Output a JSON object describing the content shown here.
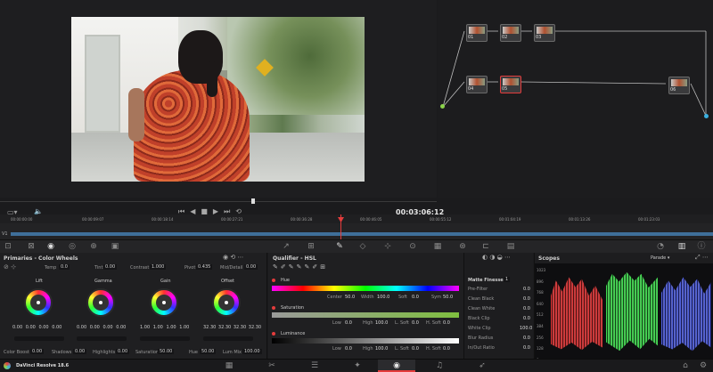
{
  "viewer": {
    "timecode": "00:03:06:12"
  },
  "timeline": {
    "track": "V1",
    "ruler": [
      "00:00:00:00",
      "00:00:09:07",
      "00:00:18:14",
      "00:00:27:21",
      "00:00:36:28",
      "00:00:46:05",
      "00:00:55:12",
      "00:01:04:19",
      "00:01:13:26",
      "00:01:23:03"
    ]
  },
  "nodes": [
    {
      "id": "01"
    },
    {
      "id": "02"
    },
    {
      "id": "03"
    },
    {
      "id": "04"
    },
    {
      "id": "05"
    },
    {
      "id": "06"
    }
  ],
  "primaries": {
    "title": "Primaries - Color Wheels",
    "top_params": [
      {
        "label": "Temp",
        "value": "0.0"
      },
      {
        "label": "Tint",
        "value": "0.00"
      },
      {
        "label": "Contrast",
        "value": "1.000"
      },
      {
        "label": "Pivot",
        "value": "0.435"
      },
      {
        "label": "Mid/Detail",
        "value": "0.00"
      }
    ],
    "wheels": [
      {
        "name": "Lift",
        "values": [
          "0.00",
          "0.00",
          "0.00",
          "0.00"
        ]
      },
      {
        "name": "Gamma",
        "values": [
          "0.00",
          "0.00",
          "0.00",
          "0.00"
        ]
      },
      {
        "name": "Gain",
        "values": [
          "1.00",
          "1.00",
          "1.00",
          "1.00"
        ]
      },
      {
        "name": "Offset",
        "values": [
          "32.30",
          "32.30",
          "32.30",
          "32.30"
        ]
      }
    ],
    "bottom_params": [
      {
        "label": "Color Boost",
        "value": "0.00"
      },
      {
        "label": "Shadows",
        "value": "0.00"
      },
      {
        "label": "Highlights",
        "value": "0.00"
      },
      {
        "label": "Saturation",
        "value": "50.00"
      },
      {
        "label": "Hue",
        "value": "50.00"
      },
      {
        "label": "Lum Mix",
        "value": "100.00"
      }
    ]
  },
  "qualifier": {
    "title": "Qualifier - HSL",
    "hue": {
      "label": "Hue",
      "center_l": "Center",
      "center": "50.0",
      "width_l": "Width",
      "width": "100.0",
      "soft_l": "Soft",
      "soft": "0.0",
      "sym_l": "Sym",
      "sym": "50.0"
    },
    "saturation": {
      "label": "Saturation",
      "low_l": "Low",
      "low": "0.0",
      "high_l": "High",
      "high": "100.0",
      "lsoft_l": "L. Soft",
      "lsoft": "0.0",
      "hsoft_l": "H. Soft",
      "hsoft": "0.0"
    },
    "luminance": {
      "label": "Luminance",
      "low_l": "Low",
      "low": "0.0",
      "high_l": "High",
      "high": "100.0",
      "lsoft_l": "L. Soft",
      "lsoft": "0.0",
      "hsoft_l": "H. Soft",
      "hsoft": "0.0"
    }
  },
  "matte": {
    "title": "Matte Finesse",
    "page": "1",
    "rows": [
      {
        "label": "Pre-Filter",
        "value": "0.0"
      },
      {
        "label": "Clean Black",
        "value": "0.0"
      },
      {
        "label": "Clean White",
        "value": "0.0"
      },
      {
        "label": "Black Clip",
        "value": "0.0"
      },
      {
        "label": "White Clip",
        "value": "100.0"
      },
      {
        "label": "Blur Radius",
        "value": "0.0"
      },
      {
        "label": "In/Out Ratio",
        "value": "0.0"
      }
    ]
  },
  "scopes": {
    "title": "Scopes",
    "mode": "Parade",
    "scale": [
      "1023",
      "896",
      "768",
      "640",
      "512",
      "384",
      "256",
      "128",
      "0"
    ]
  },
  "app": {
    "name": "DaVinci Resolve 18.6"
  },
  "colors": {
    "red": "#ff4040",
    "green": "#40ff60",
    "blue": "#4a6bff",
    "accent": "#e43c3c"
  }
}
